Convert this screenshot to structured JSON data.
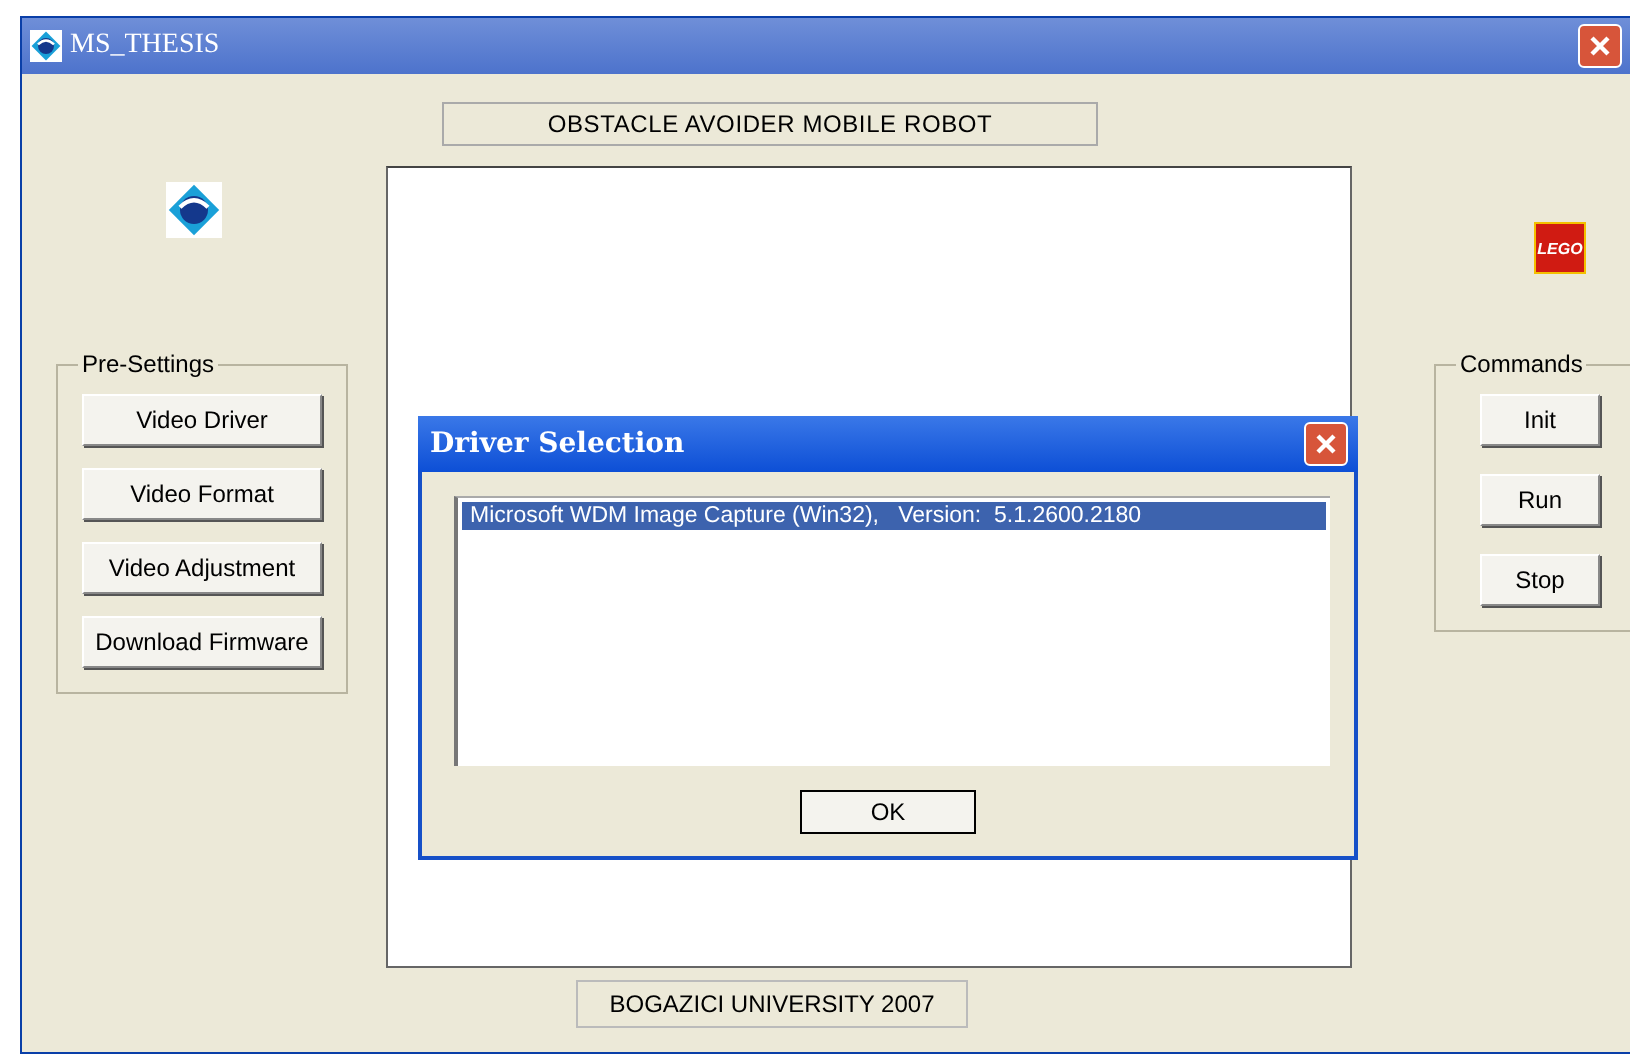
{
  "window": {
    "title": "MS_THESIS"
  },
  "header_label": "OBSTACLE AVOIDER MOBILE ROBOT",
  "pre_settings": {
    "title": "Pre-Settings",
    "buttons": [
      "Video Driver",
      "Video Format",
      "Video Adjustment",
      "Download Firmware"
    ]
  },
  "commands": {
    "title": "Commands",
    "buttons": [
      "Init",
      "Run",
      "Stop"
    ]
  },
  "lego_logo": "LEGO",
  "footer_label": "BOGAZICI UNIVERSITY 2007",
  "dialog": {
    "title": "Driver Selection",
    "items": [
      {
        "label": "Microsoft WDM Image Capture (Win32),   Version:  5.1.2600.2180",
        "selected": true
      }
    ],
    "ok_button": "OK"
  }
}
